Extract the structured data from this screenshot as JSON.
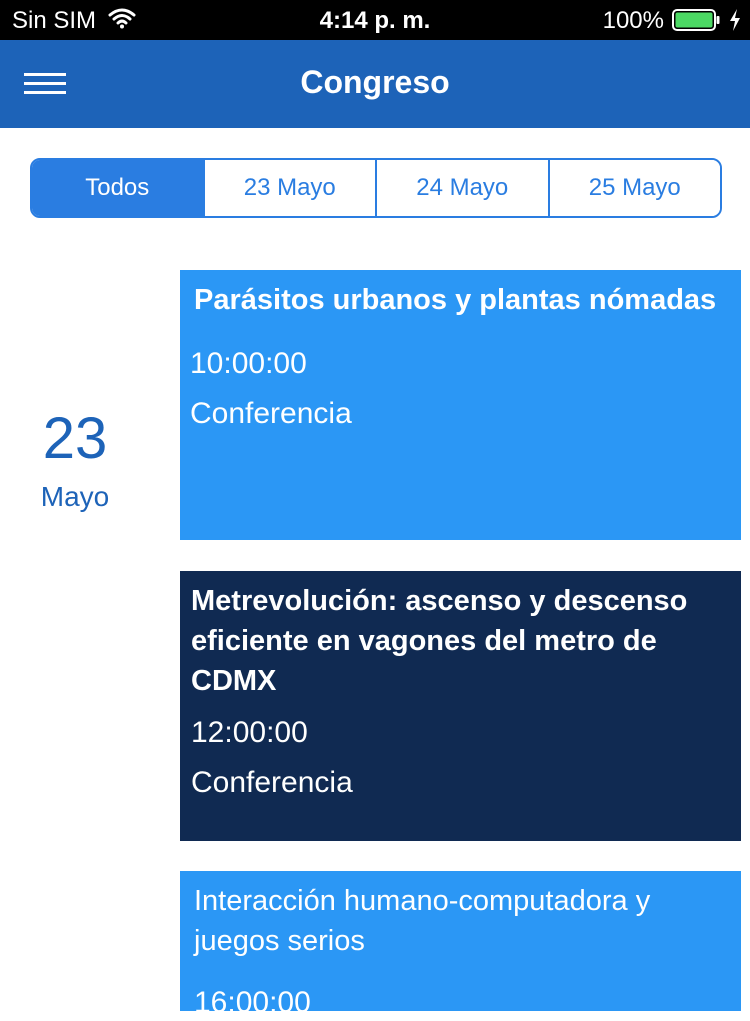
{
  "status_bar": {
    "carrier": "Sin SIM",
    "time": "4:14 p. m.",
    "battery_percent": "100%",
    "battery_level": 1.0
  },
  "nav": {
    "title": "Congreso",
    "menu_icon": "hamburger-menu-icon"
  },
  "filters": {
    "selected_index": 0,
    "items": [
      {
        "label": "Todos"
      },
      {
        "label": "23 Mayo"
      },
      {
        "label": "24 Mayo"
      },
      {
        "label": "25 Mayo"
      }
    ]
  },
  "day": {
    "number": "23",
    "month": "Mayo"
  },
  "events": [
    {
      "title": "Parásitos urbanos y plantas nómadas",
      "time": "10:00:00",
      "type": "Conferencia",
      "color": "#2b97f5"
    },
    {
      "title": "Metrevolución: ascenso y descenso eficiente en vagones del metro de CDMX",
      "time": "12:00:00",
      "type": "Conferencia",
      "color": "#102a52"
    },
    {
      "title": "Interacción humano-computadora y juegos serios",
      "time": "16:00:00",
      "type": "",
      "color": "#2b97f5"
    }
  ],
  "colors": {
    "nav_background": "#1d63b8",
    "accent": "#2a7de1",
    "card_light": "#2b97f5",
    "card_dark": "#102a52"
  }
}
